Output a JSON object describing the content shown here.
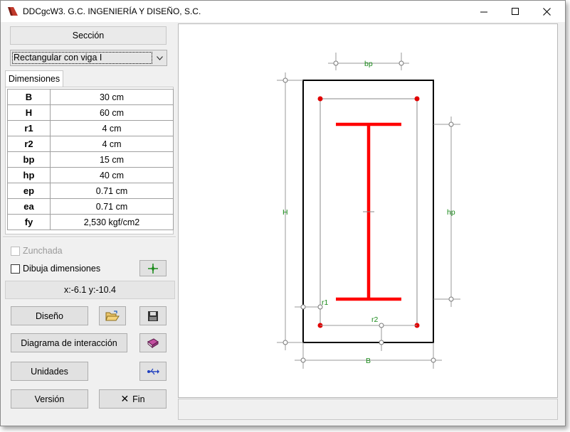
{
  "window": {
    "title": "DDCgcW3. G.C. INGENIERÍA Y DISEÑO, S.C.",
    "minimize": "—",
    "maximize": "☐",
    "close": "✕"
  },
  "section": {
    "label": "Sección",
    "selected": "Rectangular con viga I"
  },
  "tab": {
    "label": "Dimensiones"
  },
  "dimensions": [
    {
      "key": "B",
      "value": "30 cm"
    },
    {
      "key": "H",
      "value": "60 cm"
    },
    {
      "key": "r1",
      "value": "4 cm"
    },
    {
      "key": "r2",
      "value": "4 cm"
    },
    {
      "key": "bp",
      "value": "15 cm"
    },
    {
      "key": "hp",
      "value": "40 cm"
    },
    {
      "key": "ep",
      "value": "0.71 cm"
    },
    {
      "key": "ea",
      "value": "0.71 cm"
    },
    {
      "key": "fy",
      "value": "2,530 kgf/cm2"
    }
  ],
  "options": {
    "zunchada": "Zunchada",
    "dibuja": "Dibuja dimensiones"
  },
  "coords": "x:-6.1 y:-10.4",
  "buttons": {
    "diseno": "Diseño",
    "diagrama": "Diagrama de interacción",
    "unidades": "Unidades",
    "version": "Versión",
    "fin": "Fin",
    "fin_glyph": "✕"
  },
  "drawing": {
    "label_bp": "bp",
    "label_hp": "hp",
    "label_H": "H",
    "label_B": "B",
    "label_r1": "r1",
    "label_r2": "r2",
    "dim_color": "#1a8a1a",
    "beam_color": "#ff0000",
    "rebar_color": "#ff0000"
  }
}
